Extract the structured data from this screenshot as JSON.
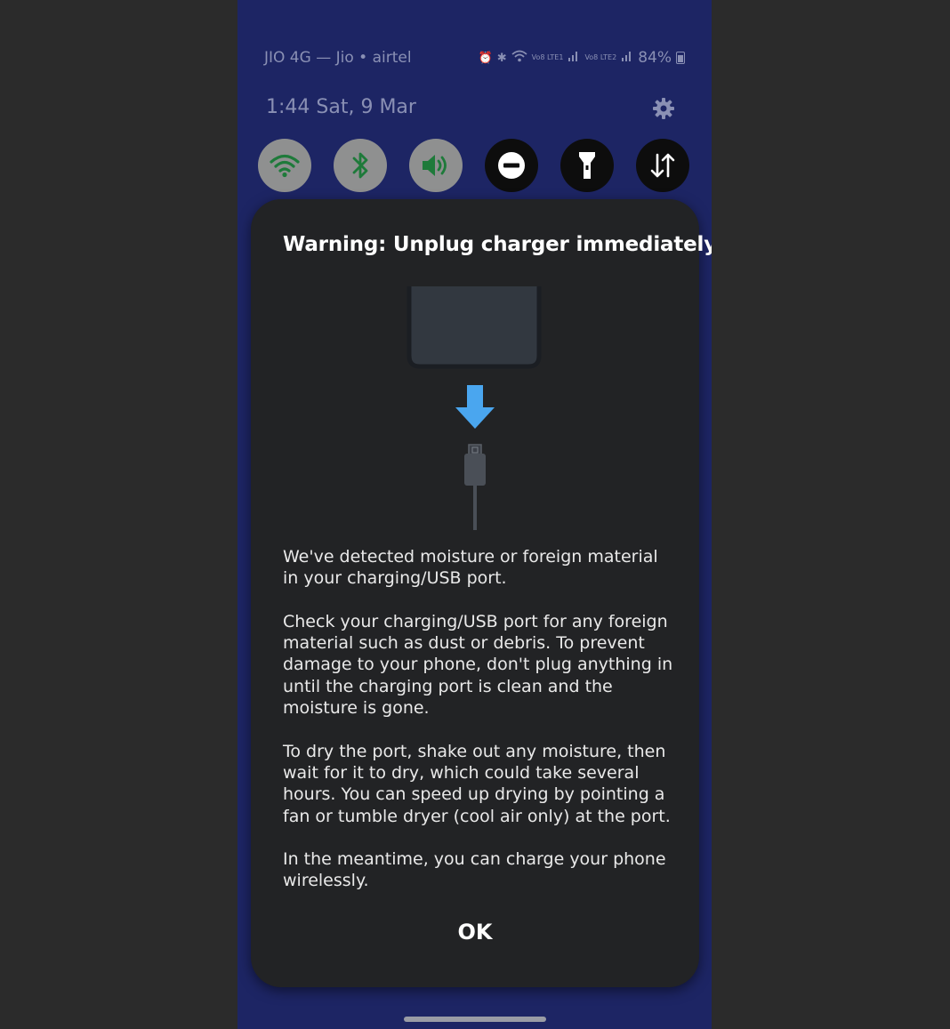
{
  "status_bar": {
    "carrier": "JIO 4G — Jio • airtel",
    "volte_label_1": "Vo8 LTE1",
    "volte_label_2": "Vo8 LTE2",
    "battery": "84%"
  },
  "header": {
    "datetime": "1:44  Sat, 9 Mar",
    "settings_icon": "gear-icon"
  },
  "quick_settings": [
    {
      "icon": "wifi-icon",
      "state": "on"
    },
    {
      "icon": "bluetooth-icon",
      "state": "on"
    },
    {
      "icon": "sound-icon",
      "state": "on"
    },
    {
      "icon": "do-not-disturb-icon",
      "state": "off"
    },
    {
      "icon": "flashlight-icon",
      "state": "off"
    },
    {
      "icon": "mobile-data-icon",
      "state": "off"
    }
  ],
  "dialog": {
    "title": "Warning: Unplug charger immediately",
    "paragraph_1": "We've detected moisture or foreign material in your charging/USB port.",
    "paragraph_2": "Check your charging/USB port for any foreign material such as dust or debris. To prevent damage to your phone, don't plug anything in until the charging port is clean and the moisture is gone.",
    "paragraph_3": "To dry the port, shake out any moisture, then wait for it to dry, which could take several hours. You can speed up drying by pointing a fan or tumble dryer (cool air only) at the port.",
    "paragraph_4": "In the meantime, you can charge your phone wirelessly.",
    "ok_label": "OK"
  },
  "colors": {
    "panel_bg": "#1d2564",
    "dialog_bg": "#222325",
    "tile_on": "#8f9090",
    "tile_on_icon": "#1e7a3a",
    "arrow": "#4aa6ef"
  }
}
